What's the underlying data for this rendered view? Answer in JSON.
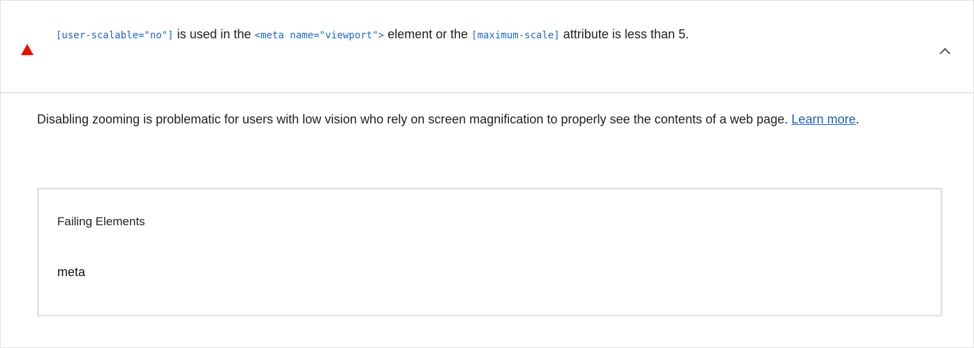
{
  "audit": {
    "status_icon": "warning-triangle-icon",
    "status_color": "#eb0f00",
    "title_parts": {
      "code1": "[user-scalable=\"no\"]",
      "text1": " is used in the ",
      "code2": "<meta name=\"viewport\">",
      "text2": " element or the ",
      "code3": "[maximum-scale]",
      "text3": " attribute is less than 5."
    },
    "expand_icon": "chevron-up-icon",
    "description": "Disabling zooming is problematic for users with low vision who rely on screen magnification to properly see the contents of a web page. ",
    "learn_more_label": "Learn more",
    "description_end": ".",
    "details": {
      "header": "Failing Elements",
      "items": [
        "meta"
      ]
    }
  }
}
